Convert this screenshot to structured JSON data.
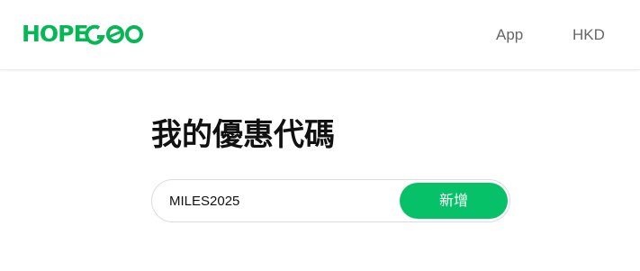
{
  "header": {
    "logo_text": "HOPEGOO",
    "brand_color": "#06b755",
    "nav": {
      "app_label": "App",
      "currency_label": "HKD"
    }
  },
  "main": {
    "title": "我的優惠代碼",
    "promo_input": {
      "value": "MILES2025",
      "placeholder": ""
    },
    "add_button_label": "新增",
    "accent_color": "#06c167"
  }
}
